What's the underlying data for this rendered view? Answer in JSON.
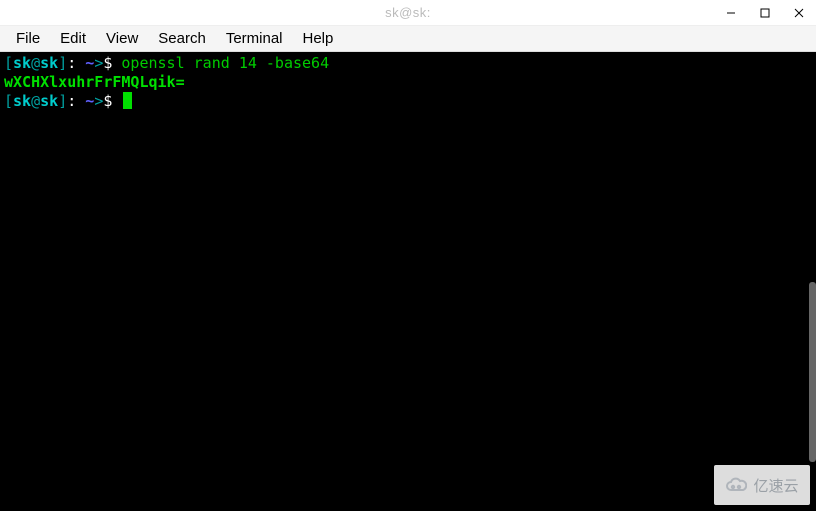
{
  "titlebar": {
    "title": "sk@sk:"
  },
  "menu": {
    "file": "File",
    "edit": "Edit",
    "view": "View",
    "search": "Search",
    "terminal": "Terminal",
    "help": "Help"
  },
  "terminal": {
    "prompt": {
      "lbracket": "[",
      "user": "sk",
      "at": "@",
      "host": "sk",
      "rbracket": "]",
      "sep": ": ",
      "path": "~",
      "gt": ">",
      "dollar": "$"
    },
    "command_parts": {
      "cmd": "openssl",
      "sub": "rand",
      "num": "14",
      "flag": "-base64"
    },
    "output_line": "wXCHXlxuhrFrFMQLqik="
  },
  "watermark": {
    "text": "亿速云"
  }
}
